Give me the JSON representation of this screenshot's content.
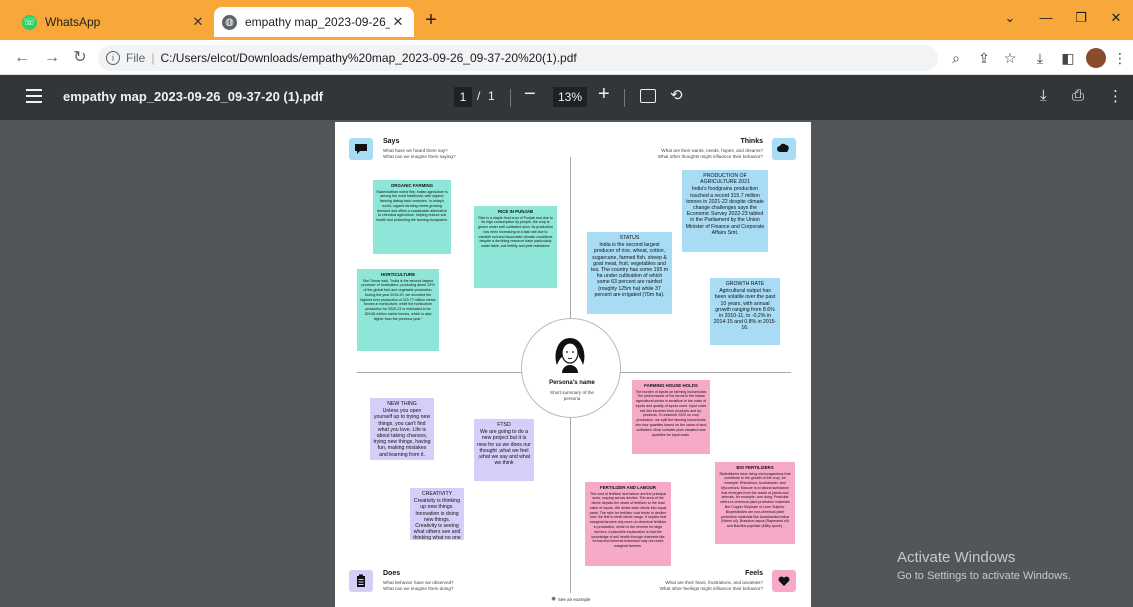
{
  "browser": {
    "tabs": [
      {
        "title": "WhatsApp",
        "icon": "whatsapp-icon"
      },
      {
        "title": "empathy map_2023-09-26_09-37-20 (1).pdf",
        "icon": "globe-icon"
      }
    ],
    "address": {
      "scheme": "File",
      "url": "C:/Users/elcot/Downloads/empathy%20map_2023-09-26_09-37-20%20(1).pdf"
    }
  },
  "pdf_toolbar": {
    "title": "empathy map_2023-09-26_09-37-20 (1).pdf",
    "current_page": "1",
    "separator": "/",
    "total_pages": "1",
    "zoom": "13%"
  },
  "empathy_map": {
    "says": {
      "title": "Says",
      "q1": "What have we heard them say?",
      "q2": "What can we imagine them saying?"
    },
    "thinks": {
      "title": "Thinks",
      "q1": "What are their wants, needs, hopes, and dreams?",
      "q2": "What other thoughts might influence their behavior?"
    },
    "does": {
      "title": "Does",
      "q1": "What behavior have we observed?",
      "q2": "What can we imagine them doing?"
    },
    "feels": {
      "title": "Feels",
      "q1": "What are their fears, frustrations, and anxieties?",
      "q2": "What other feelings might influence their behavior?"
    },
    "persona": {
      "name": "Persona's name",
      "summary": "Short summary of the persona"
    },
    "see_example": "See an example",
    "notes": {
      "organic": {
        "title": "ORGANIC FARMING",
        "body": "Swaminathan noted this: Indian agriculture is among the most traditional, with organic farming dating back centuries. In today's world, organic farming meets growing demand and offers a sustainable alternative to chemical agriculture, helping restore soil health and protecting the farming ecosystem."
      },
      "horticulture": {
        "title": "HORTICULTURE",
        "body": "Shri Tomar said, \"India is the second largest producer of horticulture, producing about 13% of the global fruit and vegetable production. During the year 2019-20, we recorded the highest ever production of 320.77 million metric tonnes in horticulture, while the horticulture production for 2020-21 is estimated to be 329.86 million metric tonnes, which is also higher than the previous year.\""
      },
      "rice": {
        "title": "RICE IN PUNJAB",
        "body": "Rice is a staple food crop of Punjab and due to its high consumption by people, the crop is grown under well cultivated area. Its production has been increasing at a fast rate due to variable soil and favourable climatic conditions despite a declining resource base particularly water table, soil fertility and pest resistance"
      },
      "status": {
        "title": "STATUS",
        "body": "India is the second largest producer of rice, wheat, cotton, sugarcane, farmed fish, sheep & goat meat, fruit, vegetables and tea. The country has some 195 m ha under cultivation of which some 63 percent are rainfed (roughly 125m ha) while 37 percent are irrigated (70m ha)."
      },
      "production": {
        "title": "PRODUCTION OF AGRICULTURE 2021",
        "body": "India's foodgrains production touched a record 315.7 million tonnes in 2021-22 despite climate change challenges says the Economic Survey 2022-23 tabled in the Parliament by the Union Minister of Finance and Corporate Affairs Smt."
      },
      "growth": {
        "title": "GROWTH RATE",
        "body": "Agricultural output has been volatile over the past 10 years, with annual growth ranging from 8.6% in 2010-11, to -0.2% in 2014-15 and 0.8% in 2015-16."
      },
      "new_thing": {
        "title": "NEW THING",
        "body": "Unless you open yourself up to trying new things, you can't find what you love. Life is about taking chances, trying new things, having fun, making mistakes and learning from it."
      },
      "ftsd": {
        "title": "FTSD",
        "body": "We are going to do a new project but it is new for us we does our thought ,what we feel ,what we say and what we think"
      },
      "creativity": {
        "title": "CREATIVITY",
        "body": "Creativity is thinking up new things. Innovation is doing new things. Creativity is seeing what others see and thinking what no one else ever thought."
      },
      "household": {
        "title": "FARMING HOUSE HOLDS",
        "body": "The burden of inputs on farming households: The performance of the farms in the Indian agricultural sector is sensitive to the costs of inputs and quality of inputs used. Input costs eat into incomes from products and by-products. To examine 2020 on crop production, we split the farming households into four quartiles based on the value of land cultivated. Most cultivate plots situated near quartiles for input costs."
      },
      "fertilizer": {
        "title": "FERTILIZER AND LABOUR",
        "body": "The cost of fertilizer and labour are the principal ones, varying across deciles. The area of the decile depicts the share of fertilizer to the total value of inputs. We divide each decile into equal parts. The ratio for fertilizer cost tends to decline over the first to tenth decile range. It implies that marginal farmers rely more on chemical fertilizer in production, which is the reverse for large farmers. A plausible explanation is that the knowledge of soil health through channels like formal and informal extension may not reach marginal farmers."
      },
      "bio": {
        "title": "BIO FERTILIZERS",
        "body": "Biofertilizers have living microorganisms that contribute to the growth of the crop, for example: Rhizobium, Azotobacter, and Mycorrhiza. Manure is a natural substance that emerges from the waste of plants and animals, for example: cow dung. Pesticide refers to chemical plant protection materials like Copper Sulphate or Lime Sulphur. Biopesticides are non-chemical plant protection materials like Azadirachta indica (Neem oil), Brassica napus (Rapeseed oil) and Bacillus popilliae (Milky spore)."
      }
    }
  },
  "watermark": {
    "title": "Activate Windows",
    "subtitle": "Go to Settings to activate Windows."
  },
  "colors": {
    "tab_strip": "#f8a73a",
    "pdf_toolbar": "#323639",
    "viewer_bg": "#525659"
  }
}
